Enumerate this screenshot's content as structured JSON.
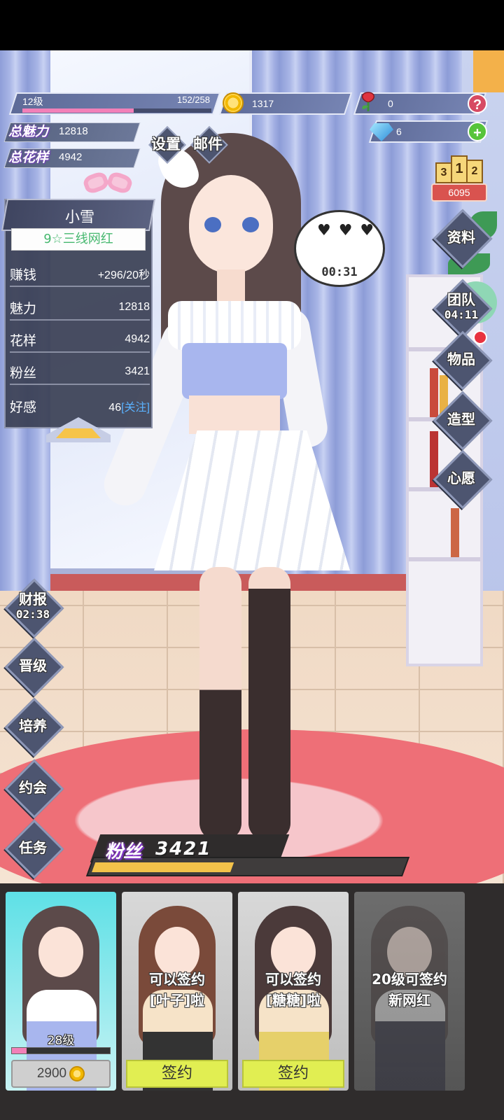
{
  "player": {
    "level_label": "12级",
    "exp_text": "152/258",
    "exp_progress": 0.589,
    "coins": "1317",
    "roses": "0",
    "diamonds": "6",
    "total_charm_label": "总魅力",
    "total_charm_value": "12818",
    "total_style_label": "总花样",
    "total_style_value": "4942"
  },
  "top_menu": {
    "settings_label": "设置",
    "mail_label": "邮件"
  },
  "ranking": {
    "podium": [
      "3",
      "1",
      "2"
    ],
    "score": "6095"
  },
  "character": {
    "name": "小雪",
    "rank": "9☆三线网红",
    "stats": [
      {
        "key": "赚钱",
        "value": "+296/20秒"
      },
      {
        "key": "魅力",
        "value": "12818"
      },
      {
        "key": "花样",
        "value": "4942"
      },
      {
        "key": "粉丝",
        "value": "3421"
      },
      {
        "key": "好感",
        "value": "46",
        "follow": "[关注]"
      }
    ],
    "bubble_timer": "00:31"
  },
  "right_menu": [
    {
      "label": "资料",
      "sub": ""
    },
    {
      "label": "团队",
      "sub": "04:11"
    },
    {
      "label": "物品",
      "sub": ""
    },
    {
      "label": "造型",
      "sub": ""
    },
    {
      "label": "心愿",
      "sub": ""
    }
  ],
  "left_menu": [
    {
      "label": "财报",
      "sub": "02:38"
    },
    {
      "label": "晋级",
      "sub": ""
    },
    {
      "label": "培养",
      "sub": ""
    },
    {
      "label": "约会",
      "sub": ""
    },
    {
      "label": "任务",
      "sub": ""
    }
  ],
  "fans": {
    "label": "粉丝",
    "value": "3421",
    "progress": 0.45
  },
  "roster": [
    {
      "type": "owned",
      "level": "28级",
      "level_progress": 0.15,
      "price": "2900"
    },
    {
      "type": "signable",
      "text_line1": "可以签约",
      "text_line2": "[叶子]啦",
      "button": "签约"
    },
    {
      "type": "signable",
      "text_line1": "可以签约",
      "text_line2": "[糖糖]啦",
      "button": "签约"
    },
    {
      "type": "locked",
      "text_line1": "20级可签约",
      "text_line2": "新网红"
    }
  ],
  "colors": {
    "exp_fill": "#f280b8",
    "fans_fill": "#f3c24a",
    "sign_button": "#e1ee52",
    "rank_text": "#46b86f",
    "follow_text": "#5ab2ff"
  },
  "icons": [
    "coin-icon",
    "rose-icon",
    "diamond-icon",
    "help-icon",
    "plus-icon",
    "podium-icon"
  ]
}
